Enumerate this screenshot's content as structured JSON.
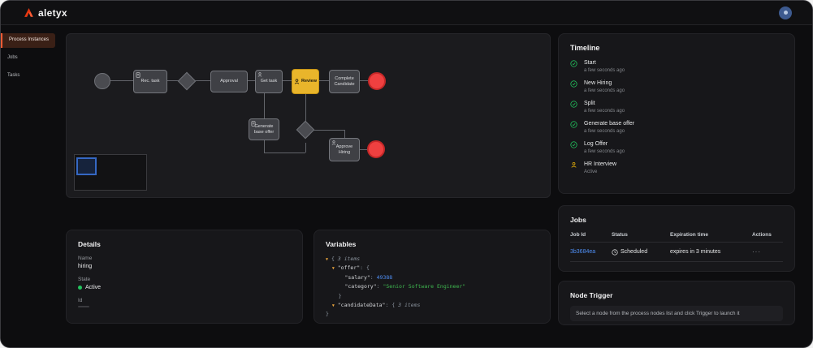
{
  "topbar": {
    "logo": "aletyx"
  },
  "sidebar": {
    "items": [
      {
        "label": "Process Instances"
      },
      {
        "label": "Jobs"
      },
      {
        "label": "Tasks"
      }
    ]
  },
  "diagram": {
    "nodes": {
      "rec_task": "Rec. task",
      "approval": "Approval",
      "get_task": "Get task",
      "review": "Review",
      "complete_candidate": "Complete Candidate",
      "generate_base_offer": "Generate base offer",
      "approve_hiring": "Approve Hiring"
    }
  },
  "timeline": {
    "title": "Timeline",
    "items": [
      {
        "label": "Start",
        "sub": "a few seconds ago"
      },
      {
        "label": "New Hiring",
        "sub": "a few seconds ago"
      },
      {
        "label": "Split",
        "sub": "a few seconds ago"
      },
      {
        "label": "Generate base offer",
        "sub": "a few seconds ago"
      },
      {
        "label": "Log Offer",
        "sub": "a few seconds ago"
      },
      {
        "label": "HR Interview",
        "sub": "Active"
      }
    ]
  },
  "details": {
    "title": "Details",
    "name_label": "Name",
    "name_value": "hiring",
    "state_label": "State",
    "state_value": "Active",
    "id_label": "Id"
  },
  "variables": {
    "title": "Variables",
    "arrow": "▼",
    "root_open": "{",
    "root_meta": "3 items",
    "offer_key": "\"offer\"",
    "colon": ":",
    "open_brace": "{",
    "salary_key": "\"salary\"",
    "salary_value": "49388",
    "category_key": "\"category\"",
    "category_value": "\"Senior Software Engineer\"",
    "close_brace": "}",
    "candidate_key": "\"candidateData\"",
    "candidate_meta": "3 items",
    "root_close": "}"
  },
  "jobs": {
    "title": "Jobs",
    "columns": [
      "Job Id",
      "Status",
      "Expiration time",
      "Actions"
    ],
    "row": {
      "id": "3b3684ea",
      "status": "Scheduled",
      "expiration": "expires in 3 minutes",
      "actions": "···"
    }
  },
  "node_trigger": {
    "title": "Node Trigger",
    "description": "Select a node from the process nodes list and click Trigger to launch it"
  },
  "colors": {
    "accent_orange": "#ff5c35",
    "active_node_yellow": "#e9b52b",
    "success_green": "#22c55e",
    "end_event_red": "#ef4040",
    "link_blue": "#4f8ff5"
  }
}
